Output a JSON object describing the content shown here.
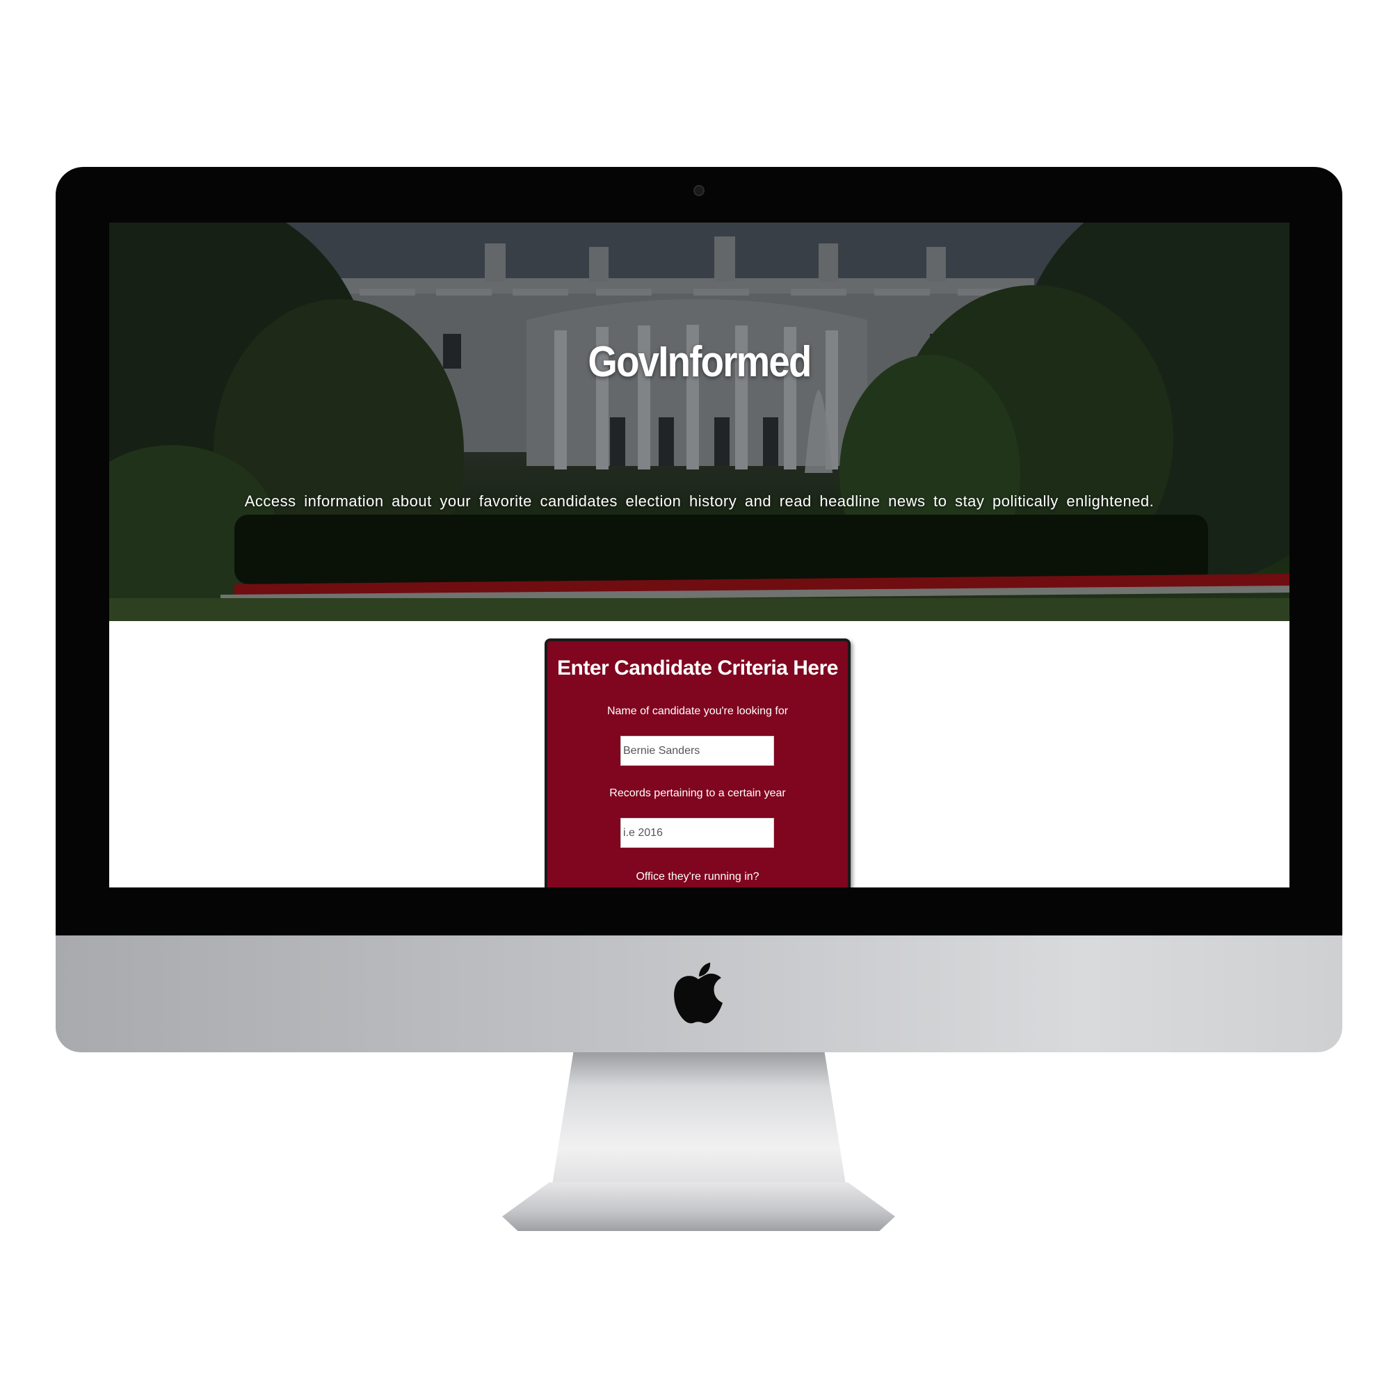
{
  "hero": {
    "title": "GovInformed",
    "tagline": "Access information about your favorite candidates election history and read headline news to stay politically enlightened."
  },
  "criteria_form": {
    "title": "Enter Candidate Criteria Here",
    "name_label": "Name of candidate you're looking for",
    "name_placeholder": "Bernie Sanders",
    "year_label": "Records pertaining to a certain year",
    "year_placeholder": "i.e 2016",
    "office_label": "Office they're running in?"
  },
  "colors": {
    "panel_background": "#80051f",
    "bezel": "#050505",
    "chin": "#c2c3c6"
  },
  "icons": [
    "apple-logo-icon",
    "camera-icon"
  ]
}
